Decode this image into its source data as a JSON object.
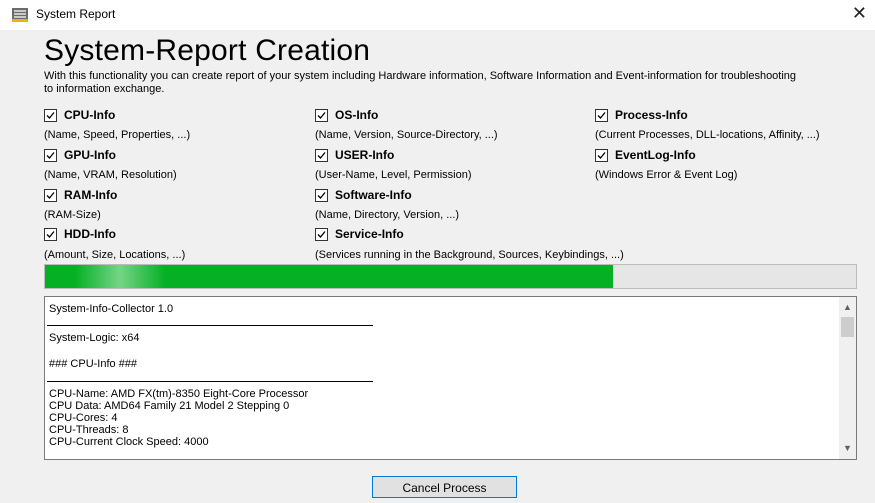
{
  "window": {
    "title": "System Report",
    "close_icon": "close-icon",
    "app_icon": "report-icon"
  },
  "header": {
    "title": "System-Report Creation",
    "description": "With this functionality you can create report of your system including Hardware information, Software Information and Event-information for troubleshooting to information exchange."
  },
  "options": {
    "cpu": {
      "label": "CPU-Info",
      "checked": true,
      "desc": "(Name, Speed, Properties, ...)"
    },
    "os": {
      "label": "OS-Info",
      "checked": true,
      "desc": "(Name, Version, Source-Directory, ...)"
    },
    "process": {
      "label": "Process-Info",
      "checked": true,
      "desc": "(Current Processes, DLL-locations, Affinity, ...)"
    },
    "gpu": {
      "label": "GPU-Info",
      "checked": true,
      "desc": "(Name, VRAM, Resolution)"
    },
    "user": {
      "label": "USER-Info",
      "checked": true,
      "desc": "(User-Name, Level, Permission)"
    },
    "eventlog": {
      "label": "EventLog-Info",
      "checked": true,
      "desc": "(Windows Error & Event Log)"
    },
    "ram": {
      "label": "RAM-Info",
      "checked": true,
      "desc": "(RAM-Size)"
    },
    "software": {
      "label": "Software-Info",
      "checked": true,
      "desc": "(Name, Directory, Version, ...)"
    },
    "hdd": {
      "label": "HDD-Info",
      "checked": true,
      "desc": "(Amount, Size, Locations, ...)"
    },
    "service": {
      "label": "Service-Info",
      "checked": true,
      "desc": "(Services running in the Background, Sources, Keybindings, ...)"
    }
  },
  "progress": {
    "fraction": 0.7,
    "color": "#06b025"
  },
  "log": {
    "lines": [
      "System-Info-Collector 1.0",
      "System-Logic: x64",
      "### CPU-Info ###",
      "CPU-Name: AMD FX(tm)-8350 Eight-Core Processor",
      "CPU Data: AMD64 Family 21 Model 2 Stepping 0",
      "CPU-Cores: 4",
      "CPU-Threads: 8",
      "CPU-Current Clock Speed: 4000"
    ]
  },
  "buttons": {
    "cancel": "Cancel Process"
  }
}
